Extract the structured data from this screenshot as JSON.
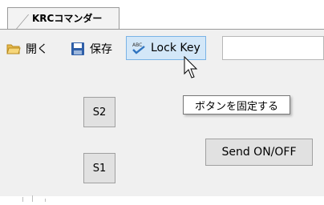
{
  "tab": {
    "label": "KRCコマンダー"
  },
  "toolbar": {
    "open_label": "開く",
    "save_label": "保存",
    "lock_label": "Lock Key",
    "input_value": "",
    "icons": {
      "open": "folder-open-icon",
      "save": "floppy-disk-icon",
      "lock": "spell-check-icon"
    }
  },
  "buttons": {
    "s2": "S2",
    "s1": "S1",
    "send": "Send ON/OFF"
  },
  "tooltip": {
    "text": "ボタンを固定する"
  },
  "colors": {
    "panel": "#f0f0f0",
    "button_face": "#e1e1e1",
    "button_border": "#a0a0a0",
    "hover_bg": "#d3e7f8",
    "hover_border": "#7ab3e6"
  }
}
